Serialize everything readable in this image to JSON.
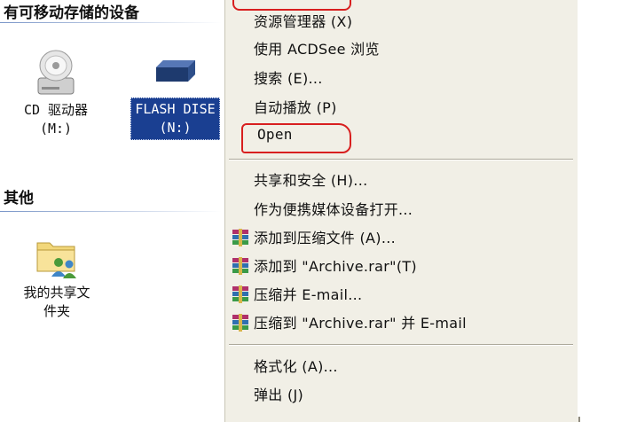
{
  "explorer": {
    "section_removable": "有可移动存储的设备",
    "section_other": "其他",
    "cd_drive": {
      "line1": "CD 驱动器",
      "line2": "(M:)",
      "icon": "cd-drive-icon"
    },
    "flash_disk": {
      "line1": "FLASH DISE",
      "line2": "(N:)",
      "icon": "removable-disk-icon"
    },
    "shared_folder": {
      "line1": "我的共享文",
      "line2": "件夹",
      "icon": "shared-folder-icon"
    }
  },
  "context_menu": {
    "items": [
      {
        "label": "资源管理器 (X)"
      },
      {
        "label": "使用 ACDSee 浏览"
      },
      {
        "label": "搜索 (E)..."
      },
      {
        "label": "自动播放 (P)"
      },
      {
        "label": "Open"
      },
      {
        "label": "共享和安全 (H)..."
      },
      {
        "label": "作为便携媒体设备打开..."
      },
      {
        "label": "添加到压缩文件 (A)...",
        "icon": "winrar-icon"
      },
      {
        "label": "添加到 \"Archive.rar\"(T)",
        "icon": "winrar-icon"
      },
      {
        "label": "压缩并 E-mail...",
        "icon": "winrar-icon"
      },
      {
        "label": "压缩到 \"Archive.rar\" 并 E-mail",
        "icon": "winrar-icon"
      },
      {
        "label": "格式化 (A)..."
      },
      {
        "label": "弹出 (J)"
      }
    ]
  },
  "colors": {
    "selection": "#1a3f91",
    "menu_bg": "#f1efe6",
    "annotation": "#d81f1f"
  }
}
